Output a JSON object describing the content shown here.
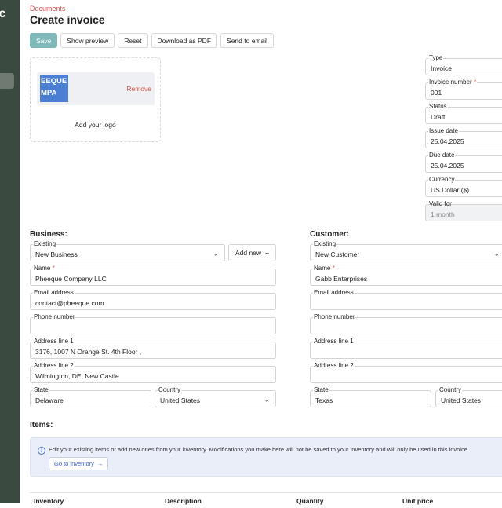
{
  "sidebar": {
    "logo_text": "ic"
  },
  "header": {
    "breadcrumb": "Documents",
    "title": "Create invoice"
  },
  "toolbar": {
    "save": "Save",
    "preview": "Show preview",
    "reset": "Reset",
    "download": "Download as PDF",
    "send": "Send to email"
  },
  "logo": {
    "image_text": "EEQUE MPA",
    "remove": "Remove",
    "add": "Add your logo"
  },
  "meta": {
    "type": {
      "label": "Type",
      "value": "Invoice"
    },
    "number": {
      "label": "Invoice number",
      "value": "001"
    },
    "status": {
      "label": "Status",
      "value": "Draft"
    },
    "issue": {
      "label": "Issue date",
      "value": "25.04.2025"
    },
    "due": {
      "label": "Due date",
      "value": "25.04.2025"
    },
    "currency": {
      "label": "Currency",
      "value": "US Dollar ($)"
    },
    "valid": {
      "label": "Valid for",
      "placeholder": "1 month"
    }
  },
  "business": {
    "heading": "Business:",
    "existing": {
      "label": "Existing",
      "value": "New Business"
    },
    "add_new": "Add new",
    "name": {
      "label": "Name",
      "value": "Pheeque Company LLC"
    },
    "email": {
      "label": "Email address",
      "value": "contact@pheeque.com"
    },
    "phone": {
      "label": "Phone number",
      "value": ""
    },
    "addr1": {
      "label": "Address line 1",
      "value": "3176, 1007 N Orange St. 4th Floor ,"
    },
    "addr2": {
      "label": "Address line 2",
      "value": "Wilmington, DE, New Castle"
    },
    "state": {
      "label": "State",
      "value": "Delaware"
    },
    "country": {
      "label": "Country",
      "value": "United States"
    }
  },
  "customer": {
    "heading": "Customer:",
    "existing": {
      "label": "Existing",
      "value": "New Customer"
    },
    "name": {
      "label": "Name",
      "value": "Gabb Enterprises"
    },
    "email": {
      "label": "Email address",
      "value": ""
    },
    "phone": {
      "label": "Phone number",
      "value": ""
    },
    "addr1": {
      "label": "Address line 1",
      "value": ""
    },
    "addr2": {
      "label": "Address line 2",
      "value": ""
    },
    "state": {
      "label": "State",
      "value": "Texas"
    },
    "country": {
      "label": "Country",
      "value": "United States"
    }
  },
  "items": {
    "heading": "Items:",
    "info_text": "Edit your existing items or add new ones from your inventory. Modifications you make here will not be saved to your inventory and will only be used in this invoice.",
    "go_inventory": "Go to inventory",
    "columns": [
      "Inventory",
      "Description",
      "Quantity",
      "Unit price"
    ]
  },
  "colors": {
    "sidebar": "#3b4a40",
    "primary": "#7fb9b9",
    "danger": "#d9534f",
    "info_bg": "#e9eef9"
  }
}
